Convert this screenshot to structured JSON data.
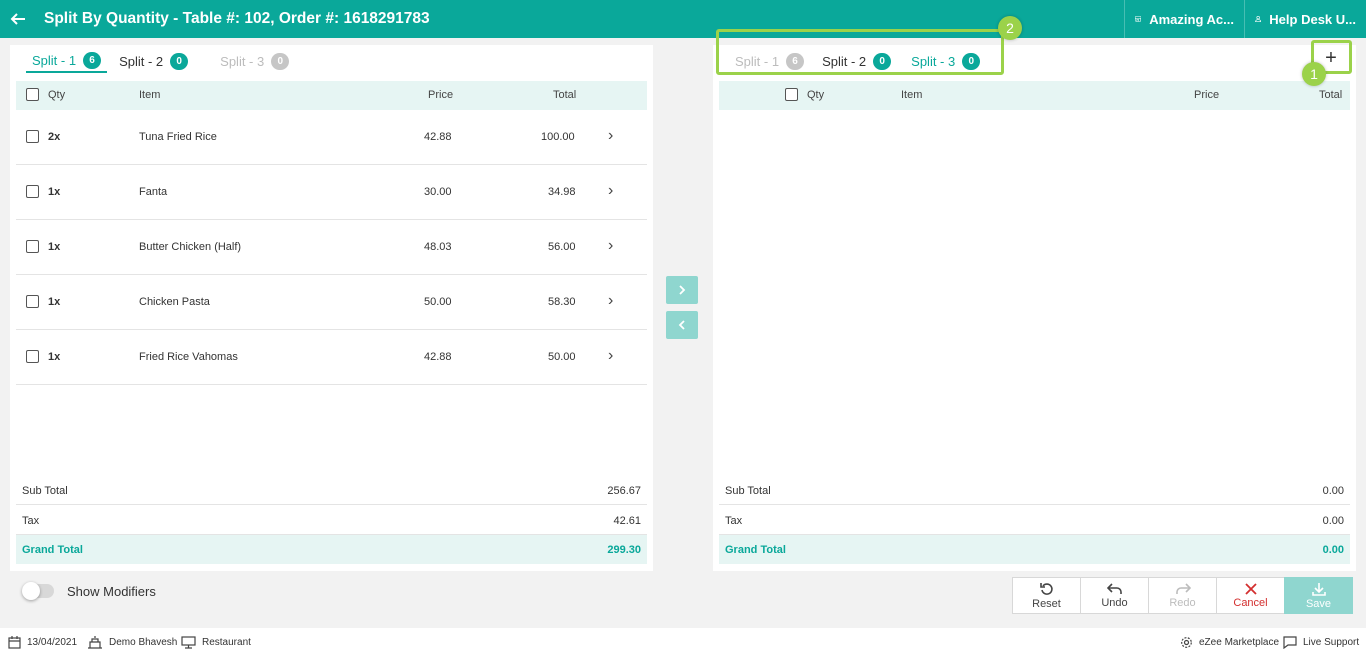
{
  "header": {
    "title": "Split By Quantity - Table #: 102, Order #: 1618291783",
    "outlet": "Amazing Ac...",
    "user": "Help Desk U..."
  },
  "left": {
    "tabs": [
      {
        "label": "Split - 1",
        "count": "6"
      },
      {
        "label": "Split - 2",
        "count": "0"
      },
      {
        "label": "Split - 3",
        "count": "0"
      }
    ],
    "columns": {
      "qty": "Qty",
      "item": "Item",
      "price": "Price",
      "total": "Total"
    },
    "rows": [
      {
        "qty": "2x",
        "item": "Tuna Fried Rice",
        "price": "42.88",
        "total": "100.00"
      },
      {
        "qty": "1x",
        "item": "Fanta",
        "price": "30.00",
        "total": "34.98"
      },
      {
        "qty": "1x",
        "item": "Butter Chicken (Half)",
        "price": "48.03",
        "total": "56.00"
      },
      {
        "qty": "1x",
        "item": "Chicken Pasta",
        "price": "50.00",
        "total": "58.30"
      },
      {
        "qty": "1x",
        "item": "Fried Rice Vahomas",
        "price": "42.88",
        "total": "50.00"
      }
    ],
    "summary": {
      "sub_total_label": "Sub Total",
      "sub_total": "256.67",
      "tax_label": "Tax",
      "tax": "42.61",
      "grand_total_label": "Grand Total",
      "grand_total": "299.30"
    }
  },
  "right": {
    "tabs": [
      {
        "label": "Split - 1",
        "count": "6"
      },
      {
        "label": "Split - 2",
        "count": "0"
      },
      {
        "label": "Split - 3",
        "count": "0"
      }
    ],
    "columns": {
      "qty": "Qty",
      "item": "Item",
      "price": "Price",
      "total": "Total"
    },
    "summary": {
      "sub_total_label": "Sub Total",
      "sub_total": "0.00",
      "tax_label": "Tax",
      "tax": "0.00",
      "grand_total_label": "Grand Total",
      "grand_total": "0.00"
    }
  },
  "annotations": {
    "marker1": "1",
    "marker2": "2"
  },
  "show_modifiers": {
    "label": "Show Modifiers",
    "enabled": false
  },
  "actions": {
    "reset": "Reset",
    "undo": "Undo",
    "redo": "Redo",
    "cancel": "Cancel",
    "save": "Save"
  },
  "footer": {
    "date": "13/04/2021",
    "user": "Demo Bhavesh",
    "terminal": "Restaurant",
    "marketplace": "eZee Marketplace",
    "support": "Live Support"
  },
  "colors": {
    "primary": "#0aa89a",
    "highlight": "#9bd24a",
    "cancel": "#d32f2f"
  }
}
